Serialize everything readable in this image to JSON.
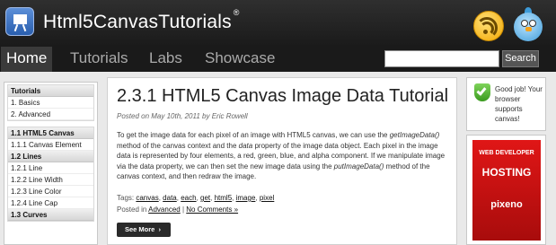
{
  "header": {
    "site_title": "Html5CanvasTutorials",
    "registered_mark": "®"
  },
  "nav": {
    "items": [
      {
        "label": "Home",
        "active": true
      },
      {
        "label": "Tutorials"
      },
      {
        "label": "Labs"
      },
      {
        "label": "Showcase"
      }
    ],
    "search_placeholder": "",
    "search_button": "Search"
  },
  "sidebar": {
    "blocks": [
      {
        "heading": "Tutorials",
        "items": [
          "1. Basics",
          "2. Advanced"
        ]
      },
      {
        "heading": "1.1 HTML5 Canvas",
        "items": [
          "1.1.1 Canvas Element"
        ]
      },
      {
        "heading": "1.2 Lines",
        "items": [
          "1.2.1 Line",
          "1.2.2 Line Width",
          "1.2.3 Line Color",
          "1.2.4 Line Cap"
        ]
      },
      {
        "heading": "1.3 Curves",
        "items": []
      }
    ]
  },
  "post": {
    "title": "2.3.1 HTML5 Canvas Image Data Tutorial",
    "meta": "Posted on May 10th, 2011 by Eric Rowell",
    "body": [
      {
        "t": "To get the image data for each pixel of an image with HTML5 canvas, we can use the "
      },
      {
        "t": "getImageData()",
        "em": true
      },
      {
        "t": " method of the canvas context and the "
      },
      {
        "t": "data",
        "em": true
      },
      {
        "t": " property of the image data object. Each pixel in the image data is represented by four elements, a red, green, blue, and alpha component. If we manipulate image via the data property, we can then set the new image data using the "
      },
      {
        "t": "putImageData()",
        "em": true
      },
      {
        "t": " method of the canvas context, and then redraw the image."
      }
    ],
    "tags_label": "Tags:",
    "tags": [
      "canvas",
      "data",
      "each",
      "get",
      "html5",
      "image",
      "pixel"
    ],
    "posted_in_label": "Posted in",
    "category": "Advanced",
    "comments": "No Comments »",
    "see_more": "See More",
    "see_more_arrow": "›"
  },
  "right_sidebar": {
    "browser_message": "Good job! Your browser supports canvas!",
    "ad": {
      "line1": "WEB DEVELOPER",
      "line2": "HOSTING",
      "brand": "pixeno",
      "color": "#d41010"
    }
  },
  "colors": {
    "header_bg": "#1f1f1f",
    "nav_active_bg": "#3a3a3a",
    "page_bg": "#e9e9e9"
  }
}
